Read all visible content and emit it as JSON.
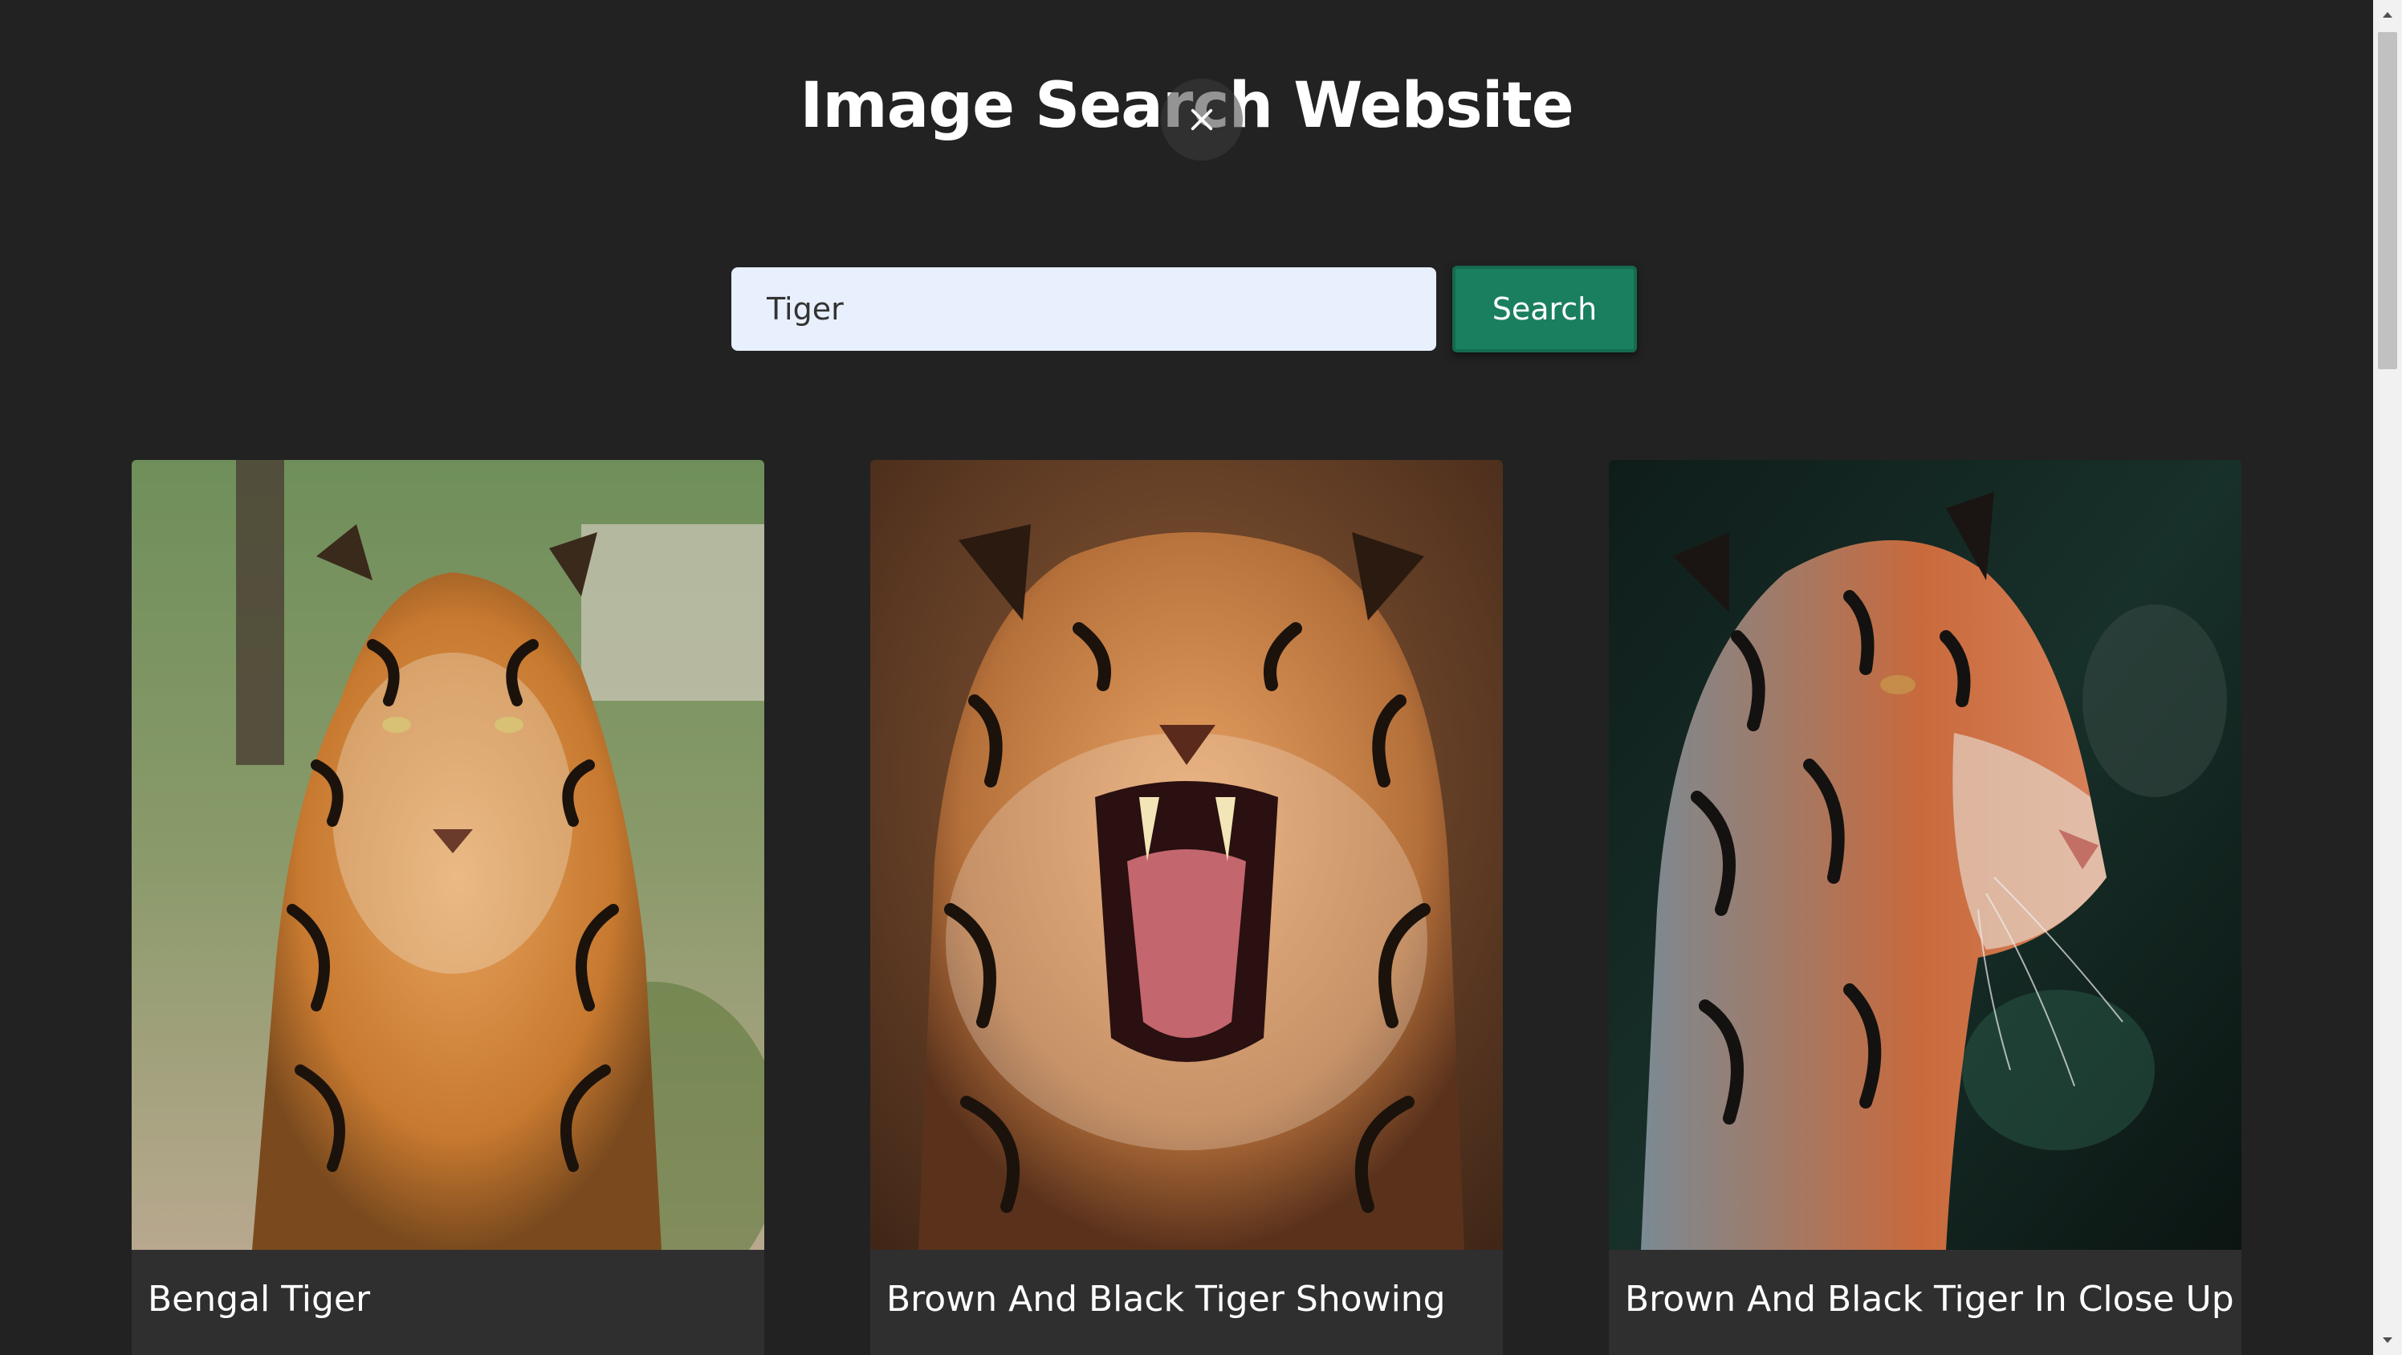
{
  "header": {
    "title": "Image Search Website"
  },
  "overlay": {
    "close_icon": "close-icon"
  },
  "search": {
    "value": "Tiger",
    "button_label": "Search"
  },
  "results": [
    {
      "title": "Bengal Tiger"
    },
    {
      "title": "Brown And Black Tiger Showing"
    },
    {
      "title": "Brown And Black Tiger In Close Up"
    }
  ],
  "colors": {
    "background": "#222222",
    "accent": "#1a7f5f",
    "input_bg": "#e8f0fe",
    "card_bg": "#2f2f30"
  }
}
